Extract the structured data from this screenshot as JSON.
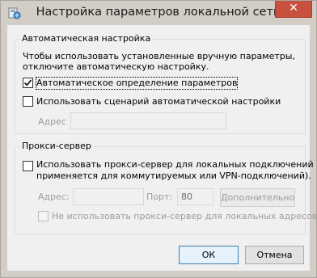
{
  "window": {
    "title": "Настройка параметров локальной сети",
    "close_glyph": "✕"
  },
  "auto_group": {
    "legend": "Автоматическая настройка",
    "description_line1": "Чтобы использовать установленные вручную параметры,",
    "description_line2": "отключите автоматическую настройку.",
    "auto_detect": {
      "label": "Автоматическое определение параметров",
      "checked": true
    },
    "use_script": {
      "label": "Использовать сценарий автоматической настройки",
      "checked": false
    },
    "address_label": "Адрес",
    "address_value": ""
  },
  "proxy_group": {
    "legend": "Прокси-сервер",
    "use_proxy_line1": "Использовать прокси-сервер для локальных подключений (не",
    "use_proxy_line2": "применяется для коммутируемых или VPN-подключений).",
    "use_proxy_checked": false,
    "address_label": "Адрес:",
    "address_value": "",
    "port_label": "Порт:",
    "port_value": "80",
    "advanced_label": "Дополнительно",
    "bypass_local_label": "Не использовать прокси-сервер для локальных адресов",
    "bypass_local_checked": false
  },
  "buttons": {
    "ok": "ОК",
    "cancel": "Отмена"
  }
}
